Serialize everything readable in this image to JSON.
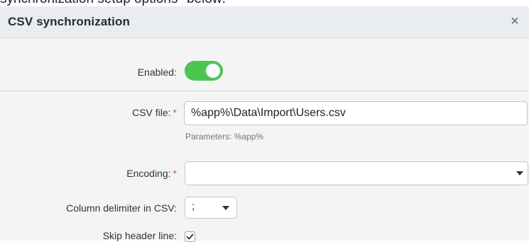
{
  "page": {
    "top_text": "synchronization setup options* below:"
  },
  "dialog": {
    "title": "CSV synchronization",
    "close_glyph": "×"
  },
  "fields": {
    "enabled": {
      "label": "Enabled:",
      "value": true
    },
    "csv_file": {
      "label": "CSV file:",
      "required_mark": "*",
      "value": "%app%\\Data\\Import\\Users.csv",
      "hint": "Parameters: %app%"
    },
    "encoding": {
      "label": "Encoding:",
      "required_mark": "*",
      "value": ""
    },
    "column_delimiter": {
      "label": "Column delimiter in CSV:",
      "value": ";"
    },
    "skip_header": {
      "label": "Skip header line:",
      "checked": true
    }
  },
  "icons": {
    "close": "close-icon",
    "dropdown": "chevron-down-icon",
    "check": "checkmark-icon"
  },
  "colors": {
    "toggle_on": "#4cc552",
    "required": "#d9534f",
    "header_bg": "#e9edf1"
  }
}
